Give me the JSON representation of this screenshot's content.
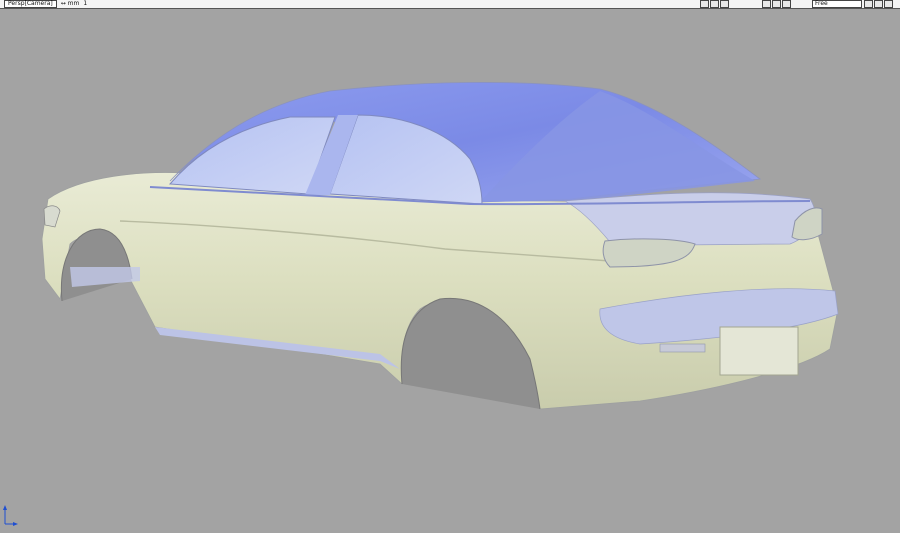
{
  "toolbar": {
    "view_label": "Persp[Camera]",
    "units_label": "↔ mm",
    "snap_label": "1",
    "mode_value": "Free"
  },
  "viewport": {
    "background_color": "#a3a3a3",
    "model": "car-body-surface"
  },
  "icons": {
    "view_tools": [
      "save-view-icon",
      "cursor-icon",
      "zoom-icon"
    ],
    "camera_tools": [
      "orbit-icon",
      "pan-icon",
      "fit-icon"
    ],
    "window_tools": [
      "layout-icon",
      "maximize-icon",
      "close-icon"
    ]
  }
}
